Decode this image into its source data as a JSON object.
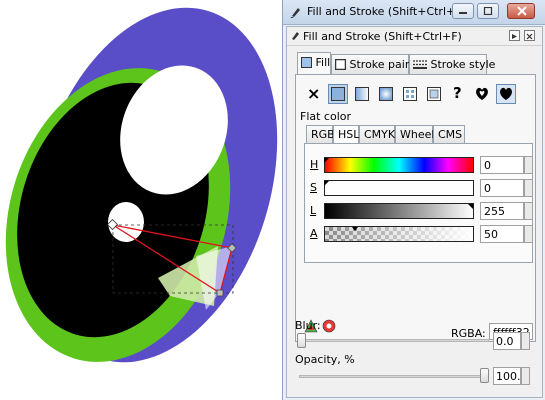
{
  "window": {
    "title": "Fill and Stroke (Shift+Ctrl+F)",
    "buttons": [
      "minimize",
      "maximize",
      "close"
    ]
  },
  "dock": {
    "title": "Fill and Stroke (Shift+Ctrl+F)"
  },
  "tabs": [
    {
      "label": "Fill",
      "active": true
    },
    {
      "label": "Stroke paint",
      "active": false
    },
    {
      "label": "Stroke style",
      "active": false
    }
  ],
  "paint_modes": {
    "no_paint_symbol": "×",
    "unset_symbol": "?",
    "selected": "flat-color"
  },
  "flat_color": {
    "label": "Flat color",
    "subtabs": [
      {
        "label": "RGB",
        "active": false
      },
      {
        "label": "HSL",
        "active": true
      },
      {
        "label": "CMYK",
        "active": false
      },
      {
        "label": "Wheel",
        "active": false
      },
      {
        "label": "CMS",
        "active": false
      }
    ],
    "sliders": [
      {
        "label": "H",
        "value": "0",
        "level": 0
      },
      {
        "label": "S",
        "value": "0",
        "level": 0
      },
      {
        "label": "L",
        "value": "255",
        "level": 1
      },
      {
        "label": "A",
        "value": "50",
        "level": 0.2
      }
    ],
    "rgba_label": "RGBA:",
    "rgba_value": "ffffff32"
  },
  "blur": {
    "label": "Blur:",
    "value": "0.0",
    "level": 0
  },
  "opacity": {
    "label": "Opacity, %",
    "value": "100.0",
    "level": 1
  },
  "colors": {
    "outer_ellipse": "#5a4ec8",
    "green_ring": "#5cc41b",
    "iris": "#000000",
    "highlight": "#ffffff",
    "gradient_line": "#e0141a",
    "translucent_shape": "#cfeaa8"
  }
}
